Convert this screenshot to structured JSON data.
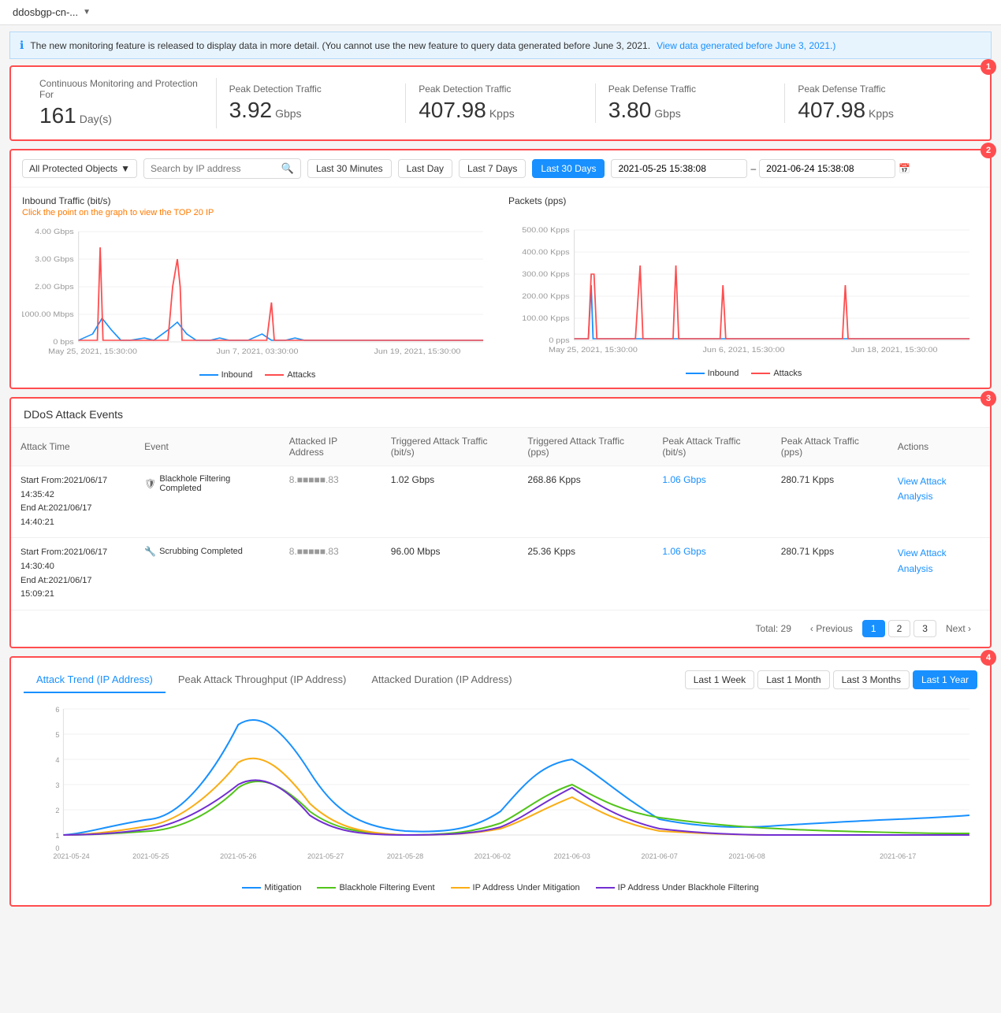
{
  "header": {
    "title": "ddosbgp-cn-...",
    "chevron": "▼"
  },
  "banner": {
    "text": "The new monitoring feature is released to display data in more detail. (You cannot use the new feature to query data generated before June 3, 2021.",
    "link_text": "View data generated before June 3, 2021.)",
    "link_url": "#"
  },
  "stats": {
    "badge": "1",
    "items": [
      {
        "label": "Continuous Monitoring and Protection For",
        "value": "161",
        "unit": "Day(s)"
      },
      {
        "label": "Peak Detection Traffic",
        "value": "3.92",
        "unit": "Gbps"
      },
      {
        "label": "Peak Detection Traffic",
        "value": "407.98",
        "unit": "Kpps"
      },
      {
        "label": "Peak Defense Traffic",
        "value": "3.80",
        "unit": "Gbps"
      },
      {
        "label": "Peak Defense Traffic",
        "value": "407.98",
        "unit": "Kpps"
      }
    ]
  },
  "filters": {
    "badge": "2",
    "protected_objects_label": "All Protected Objects",
    "search_placeholder": "Search by IP address",
    "time_buttons": [
      {
        "label": "Last 30 Minutes",
        "active": false
      },
      {
        "label": "Last Day",
        "active": false
      },
      {
        "label": "Last 7 Days",
        "active": false
      },
      {
        "label": "Last 30 Days",
        "active": true
      }
    ],
    "date_from": "2021-05-25 15:38:08",
    "date_to": "2021-06-24 15:38:08"
  },
  "charts": {
    "inbound_title": "Inbound Traffic (bit/s)",
    "inbound_subtitle": "Click the point on the graph to view the TOP 20 IP",
    "packets_title": "Packets (pps)",
    "inbound_legend": [
      {
        "label": "Inbound",
        "color": "#1890ff"
      },
      {
        "label": "Attacks",
        "color": "#ff4d4f"
      }
    ],
    "left_y_labels": [
      "4.00 Gbps",
      "3.00 Gbps",
      "2.00 Gbps",
      "1000.00 Mbps",
      "0 bps"
    ],
    "left_x_labels": [
      "May 25, 2021, 15:30:00",
      "Jun 7, 2021, 03:30:00",
      "Jun 19, 2021, 15:30:00"
    ],
    "right_y_labels": [
      "500.00 Kpps",
      "400.00 Kpps",
      "300.00 Kpps",
      "200.00 Kpps",
      "100.00 Kpps",
      "0 pps"
    ],
    "right_x_labels": [
      "May 25, 2021, 15:30:00",
      "Jun 6, 2021, 15:30:00",
      "Jun 18, 2021, 15:30:00"
    ]
  },
  "ddos_events": {
    "badge": "3",
    "title": "DDoS Attack Events",
    "columns": [
      "Attack Time",
      "Event",
      "Attacked IP Address",
      "Triggered Attack Traffic (bit/s)",
      "Triggered Attack Traffic (pps)",
      "Peak Attack Traffic (bit/s)",
      "Peak Attack Traffic (pps)",
      "Actions"
    ],
    "rows": [
      {
        "time_start": "Start From:2021/06/17",
        "time_start2": "14:35:42",
        "time_end": "End At:2021/06/17 14:40:21",
        "event_type": "Blackhole Filtering Completed",
        "event_icon": "🛡",
        "ip": "8.■■■■■.83",
        "triggered_bits": "1.02 Gbps",
        "triggered_pps": "268.86 Kpps",
        "peak_bits": "1.06 Gbps",
        "peak_pps": "280.71 Kpps",
        "action": "View Attack Analysis"
      },
      {
        "time_start": "Start From:2021/06/17",
        "time_start2": "14:30:40",
        "time_end": "End At:2021/06/17 15:09:21",
        "event_type": "Scrubbing Completed",
        "event_icon": "🔧",
        "ip": "8.■■■■■.83",
        "triggered_bits": "96.00 Mbps",
        "triggered_pps": "25.36 Kpps",
        "peak_bits": "1.06 Gbps",
        "peak_pps": "280.71 Kpps",
        "action": "View Attack Analysis"
      }
    ],
    "pagination": {
      "total_label": "Total: 29",
      "previous_label": "< Previous",
      "next_label": "Next >",
      "pages": [
        "1",
        "2",
        "3"
      ],
      "current_page": "1"
    }
  },
  "attack_trend": {
    "badge": "4",
    "tabs": [
      {
        "label": "Attack Trend (IP Address)",
        "active": true
      },
      {
        "label": "Peak Attack Throughput (IP Address)",
        "active": false
      },
      {
        "label": "Attacked Duration (IP Address)",
        "active": false
      }
    ],
    "time_buttons": [
      {
        "label": "Last 1 Week",
        "active": false
      },
      {
        "label": "Last 1 Month",
        "active": false
      },
      {
        "label": "Last 3 Months",
        "active": false
      },
      {
        "label": "Last 1 Year",
        "active": true
      }
    ],
    "y_labels": [
      "6",
      "5",
      "4",
      "3",
      "2",
      "1",
      "0"
    ],
    "x_labels": [
      "2021-05-24",
      "2021-05-25",
      "2021-05-26",
      "2021-05-27",
      "2021-05-28",
      "2021-06-02",
      "2021-06-03",
      "2021-06-07",
      "2021-06-08",
      "2021-06-17"
    ],
    "legend": [
      {
        "label": "Mitigation",
        "color": "#1890ff"
      },
      {
        "label": "Blackhole Filtering Event",
        "color": "#52c41a"
      },
      {
        "label": "IP Address Under Mitigation",
        "color": "#faad14"
      },
      {
        "label": "IP Address Under Blackhole Filtering",
        "color": "#722ed1"
      }
    ]
  }
}
